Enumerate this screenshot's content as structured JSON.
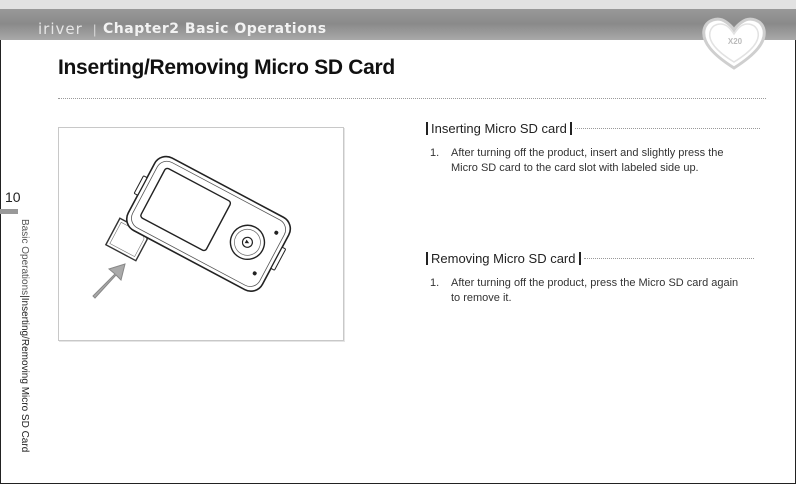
{
  "header": {
    "brand": "iriver",
    "separator": "|",
    "chapter": "Chapter2",
    "section": "Basic Operations",
    "badge": "X20"
  },
  "page": {
    "title": "Inserting/Removing Micro SD Card",
    "number": "10"
  },
  "sidebar": {
    "category": "Basic Operations",
    "pipe": "|",
    "topic": "Inserting/Removing Micro SD Card"
  },
  "sections": [
    {
      "heading": "Inserting Micro SD card",
      "steps": [
        {
          "num": "1.",
          "text": "After turning off the product, insert and slightly press the Micro SD card to the card slot with labeled side up."
        }
      ]
    },
    {
      "heading": "Removing Micro SD card",
      "steps": [
        {
          "num": "1.",
          "text": "After turning off the product, press the Micro SD card again to remove it."
        }
      ]
    }
  ]
}
